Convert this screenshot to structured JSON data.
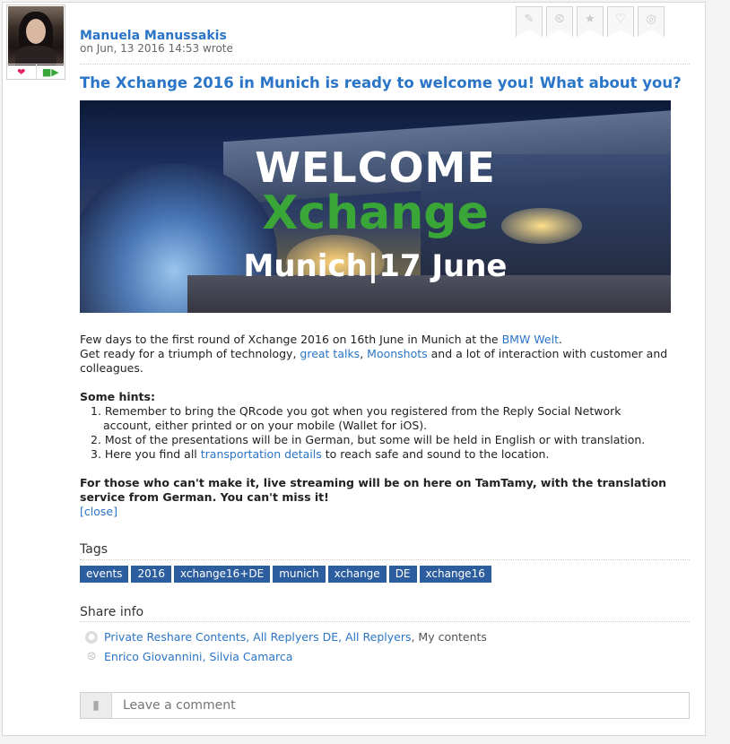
{
  "post": {
    "author": "Manuela Manussakis",
    "posted": "on Jun, 13 2016 14:53 wrote",
    "title": "The Xchange 2016 in Munich is ready to welcome you! What about you?",
    "banner": {
      "line1": "WELCOME",
      "line2": "Xchange",
      "line3": "Munich|17 June"
    },
    "intro_1a": "Few days to the first round of Xchange 2016 on 16th June in Munich at the ",
    "intro_1_link": "BMW Welt",
    "intro_1b": ".",
    "intro_2a": "Get ready for a  triumph of technology, ",
    "intro_2_link1": "great talks",
    "intro_2_sep": ", ",
    "intro_2_link2": "Moonshots",
    "intro_2b": " and a lot of interaction with customer and colleagues.",
    "hints_title": "Some hints:",
    "hint1": "1. Remember to bring the QRcode you got when you registered from the Reply Social Network account, either printed or on your mobile (Wallet for iOS).",
    "hint2": "2. Most of the presentations will be in German, but some will be held in English or with translation.",
    "hint3a": "3. Here you find all ",
    "hint3_link": "transportation details",
    "hint3b": " to reach safe and sound to the location.",
    "closing": "For those who can't make it, live streaming will be on here on TamTamy, with the translation service from German. You can't miss it!",
    "close_link": "[close]"
  },
  "tags": {
    "label": "Tags",
    "items": [
      "events",
      "2016",
      "xchange16+DE",
      "munich",
      "xchange",
      "DE",
      "xchange16"
    ]
  },
  "share": {
    "label": "Share info",
    "groups_links": "Private Reshare Contents, All Replyers DE, All Replyers",
    "groups_tail": ", My contents",
    "people": "Enrico Giovannini, Silvia Camarca"
  },
  "comment": {
    "placeholder": "Leave a comment"
  },
  "colors": {
    "link": "#2a75c7",
    "tag_bg": "#2b5d9f",
    "accent_green": "#3aa638"
  }
}
